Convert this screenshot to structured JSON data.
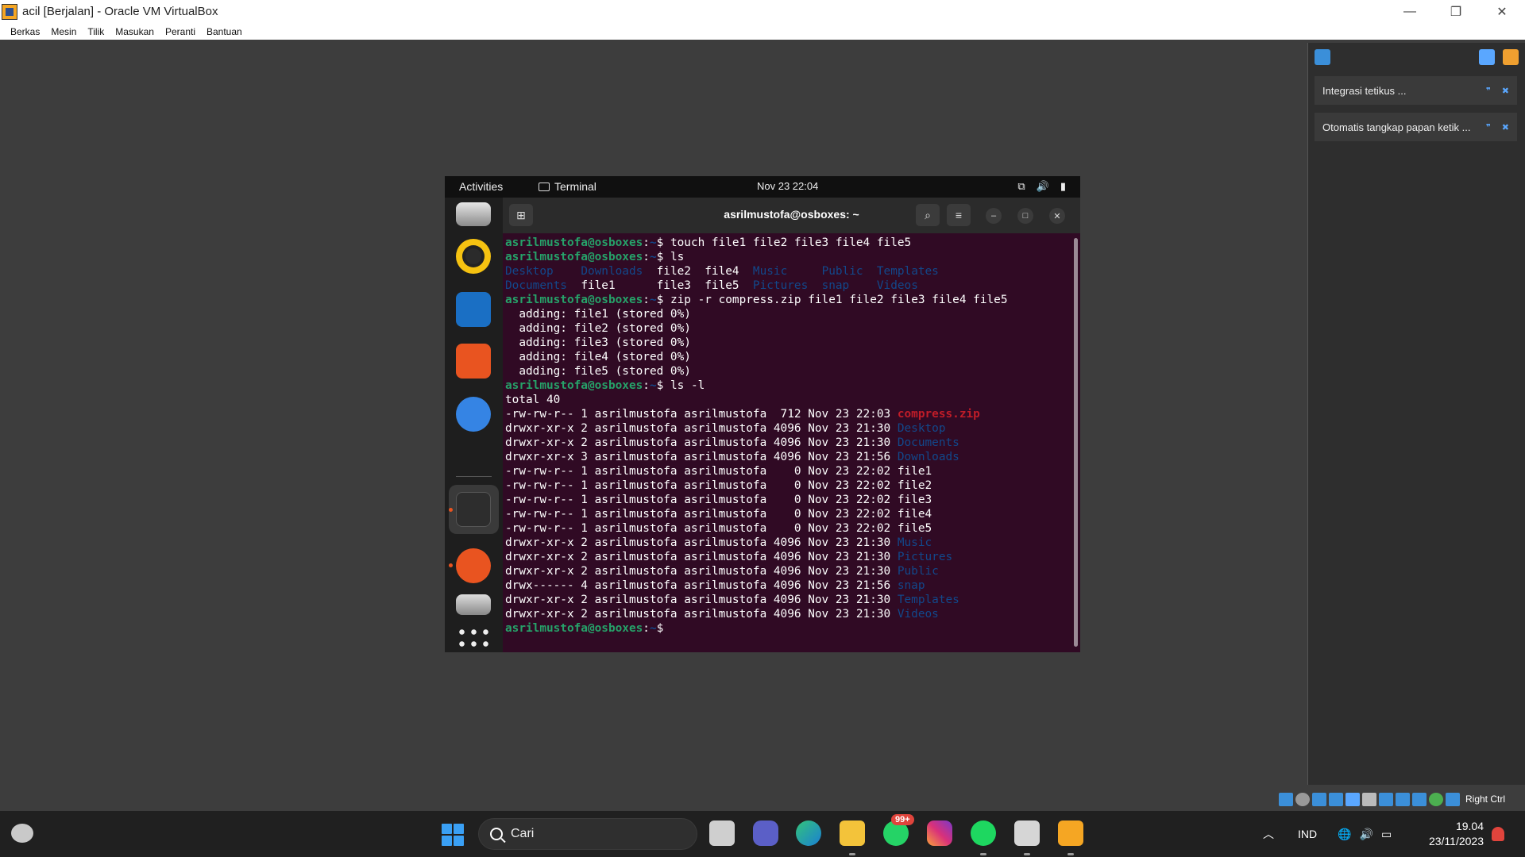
{
  "host": {
    "window_title": "acil [Berjalan] - Oracle VM VirtualBox",
    "window_controls": {
      "minimize": "—",
      "restore": "❐",
      "close": "✕"
    },
    "menu": [
      "Berkas",
      "Mesin",
      "Tilik",
      "Masukan",
      "Peranti",
      "Bantuan"
    ],
    "notifications": [
      {
        "text": "Integrasi tetikus ..."
      },
      {
        "text": "Otomatis tangkap papan ketik ..."
      }
    ],
    "status_host_key": "Right Ctrl"
  },
  "guest": {
    "topbar": {
      "activities": "Activities",
      "app_name": "Terminal",
      "clock": "Nov 23  22:04"
    },
    "terminal": {
      "title": "asrilmustofa@osboxes: ~",
      "prompt_user": "asrilmustofa@osboxes",
      "prompt_path": "~",
      "lines": [
        {
          "type": "prompt",
          "cmd": "touch file1 file2 file3 file4 file5"
        },
        {
          "type": "prompt",
          "cmd": "ls"
        },
        {
          "type": "segs",
          "segs": [
            {
              "t": "Desktop    ",
              "c": "dir"
            },
            {
              "t": "Downloads  ",
              "c": "dir"
            },
            {
              "t": "file2  file4  ",
              "c": ""
            },
            {
              "t": "Music     ",
              "c": "dir"
            },
            {
              "t": "Public  ",
              "c": "dir"
            },
            {
              "t": "Templates",
              "c": "dir"
            }
          ]
        },
        {
          "type": "segs",
          "segs": [
            {
              "t": "Documents  ",
              "c": "dir"
            },
            {
              "t": "file1      file3  file5  ",
              "c": ""
            },
            {
              "t": "Pictures  ",
              "c": "dir"
            },
            {
              "t": "snap    ",
              "c": "dir"
            },
            {
              "t": "Videos",
              "c": "dir"
            }
          ]
        },
        {
          "type": "prompt",
          "cmd": "zip -r compress.zip file1 file2 file3 file4 file5"
        },
        {
          "type": "text",
          "t": "  adding: file1 (stored 0%)"
        },
        {
          "type": "text",
          "t": "  adding: file2 (stored 0%)"
        },
        {
          "type": "text",
          "t": "  adding: file3 (stored 0%)"
        },
        {
          "type": "text",
          "t": "  adding: file4 (stored 0%)"
        },
        {
          "type": "text",
          "t": "  adding: file5 (stored 0%)"
        },
        {
          "type": "prompt",
          "cmd": "ls -l"
        },
        {
          "type": "text",
          "t": "total 40"
        },
        {
          "type": "ll",
          "pre": "-rw-rw-r-- 1 asrilmustofa asrilmustofa  712 Nov 23 22:03 ",
          "name": "compress.zip",
          "c": "zip"
        },
        {
          "type": "ll",
          "pre": "drwxr-xr-x 2 asrilmustofa asrilmustofa 4096 Nov 23 21:30 ",
          "name": "Desktop",
          "c": "dir"
        },
        {
          "type": "ll",
          "pre": "drwxr-xr-x 2 asrilmustofa asrilmustofa 4096 Nov 23 21:30 ",
          "name": "Documents",
          "c": "dir"
        },
        {
          "type": "ll",
          "pre": "drwxr-xr-x 3 asrilmustofa asrilmustofa 4096 Nov 23 21:56 ",
          "name": "Downloads",
          "c": "dir"
        },
        {
          "type": "ll",
          "pre": "-rw-rw-r-- 1 asrilmustofa asrilmustofa    0 Nov 23 22:02 ",
          "name": "file1",
          "c": ""
        },
        {
          "type": "ll",
          "pre": "-rw-rw-r-- 1 asrilmustofa asrilmustofa    0 Nov 23 22:02 ",
          "name": "file2",
          "c": ""
        },
        {
          "type": "ll",
          "pre": "-rw-rw-r-- 1 asrilmustofa asrilmustofa    0 Nov 23 22:02 ",
          "name": "file3",
          "c": ""
        },
        {
          "type": "ll",
          "pre": "-rw-rw-r-- 1 asrilmustofa asrilmustofa    0 Nov 23 22:02 ",
          "name": "file4",
          "c": ""
        },
        {
          "type": "ll",
          "pre": "-rw-rw-r-- 1 asrilmustofa asrilmustofa    0 Nov 23 22:02 ",
          "name": "file5",
          "c": ""
        },
        {
          "type": "ll",
          "pre": "drwxr-xr-x 2 asrilmustofa asrilmustofa 4096 Nov 23 21:30 ",
          "name": "Music",
          "c": "dir"
        },
        {
          "type": "ll",
          "pre": "drwxr-xr-x 2 asrilmustofa asrilmustofa 4096 Nov 23 21:30 ",
          "name": "Pictures",
          "c": "dir"
        },
        {
          "type": "ll",
          "pre": "drwxr-xr-x 2 asrilmustofa asrilmustofa 4096 Nov 23 21:30 ",
          "name": "Public",
          "c": "dir"
        },
        {
          "type": "ll",
          "pre": "drwx------ 4 asrilmustofa asrilmustofa 4096 Nov 23 21:56 ",
          "name": "snap",
          "c": "dir"
        },
        {
          "type": "ll",
          "pre": "drwxr-xr-x 2 asrilmustofa asrilmustofa 4096 Nov 23 21:30 ",
          "name": "Templates",
          "c": "dir"
        },
        {
          "type": "ll",
          "pre": "drwxr-xr-x 2 asrilmustofa asrilmustofa 4096 Nov 23 21:30 ",
          "name": "Videos",
          "c": "dir"
        },
        {
          "type": "prompt",
          "cmd": ""
        }
      ]
    }
  },
  "taskbar": {
    "search_label": "Cari",
    "whatsapp_badge": "99+",
    "language": "IND",
    "time": "19.04",
    "date": "23/11/2023"
  },
  "colors": {
    "terminal_bg": "#300a24",
    "prompt_user": "#26a269",
    "dir_blue": "#12488b",
    "zip_red": "#c01c28",
    "ubuntu_orange": "#e95420"
  }
}
